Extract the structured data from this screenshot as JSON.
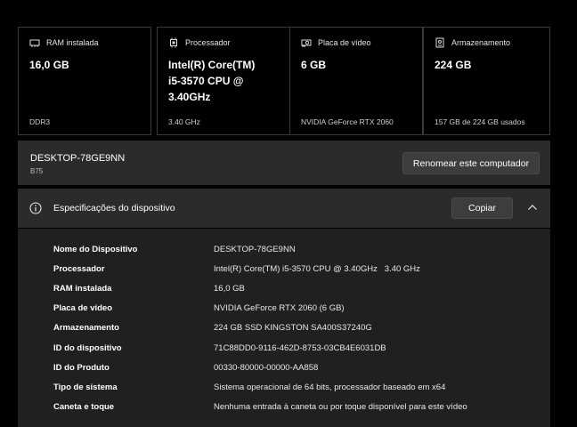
{
  "cards": [
    {
      "label": "RAM instalada",
      "value": "16,0 GB",
      "sub": "DDR3",
      "icon": "ram-icon"
    },
    {
      "label": "Processador",
      "value": "Intel(R) Core(TM) i5-3570 CPU @ 3.40GHz",
      "value_lines": [
        "Intel(R) Core(TM)",
        "i5-3570 CPU @",
        "3.40GHz"
      ],
      "sub": "3.40 GHz",
      "icon": "processor-icon"
    },
    {
      "label": "Placa de vídeo",
      "value": "6 GB",
      "sub": "NVIDIA GeForce RTX 2060",
      "icon": "gpu-icon"
    },
    {
      "label": "Armazenamento",
      "value": "224 GB",
      "sub": "157 GB de 224 GB usados",
      "icon": "storage-icon"
    }
  ],
  "device": {
    "name": "DESKTOP-78GE9NN",
    "model": "B75",
    "rename_label": "Renomear este computador"
  },
  "specs": {
    "title": "Especificações do dispositivo",
    "copy_label": "Copiar",
    "rows": [
      {
        "key": "Nome do Dispositivo",
        "value": "DESKTOP-78GE9NN"
      },
      {
        "key": "Processador",
        "value": "Intel(R) Core(TM) i5-3570 CPU @ 3.40GHz   3.40 GHz"
      },
      {
        "key": "RAM instalada",
        "value": "16,0 GB"
      },
      {
        "key": "Placa de vídeo",
        "value": "NVIDIA GeForce RTX 2060 (6 GB)"
      },
      {
        "key": "Armazenamento",
        "value": "224 GB SSD KINGSTON SA400S37240G"
      },
      {
        "key": "ID do dispositivo",
        "value": "71C88DD0-9116-462D-8753-03CB4E6031DB"
      },
      {
        "key": "ID do Produto",
        "value": "00330-80000-00000-AA858"
      },
      {
        "key": "Tipo de sistema",
        "value": "Sistema operacional de 64 bits, processador baseado em x64"
      },
      {
        "key": "Caneta e toque",
        "value": "Nenhuma entrada à caneta ou por toque disponível para este vídeo"
      }
    ]
  },
  "colors": {
    "background": "#000000",
    "panel": "#2b2b2b",
    "body": "#202020",
    "button": "#3d3d3d"
  }
}
